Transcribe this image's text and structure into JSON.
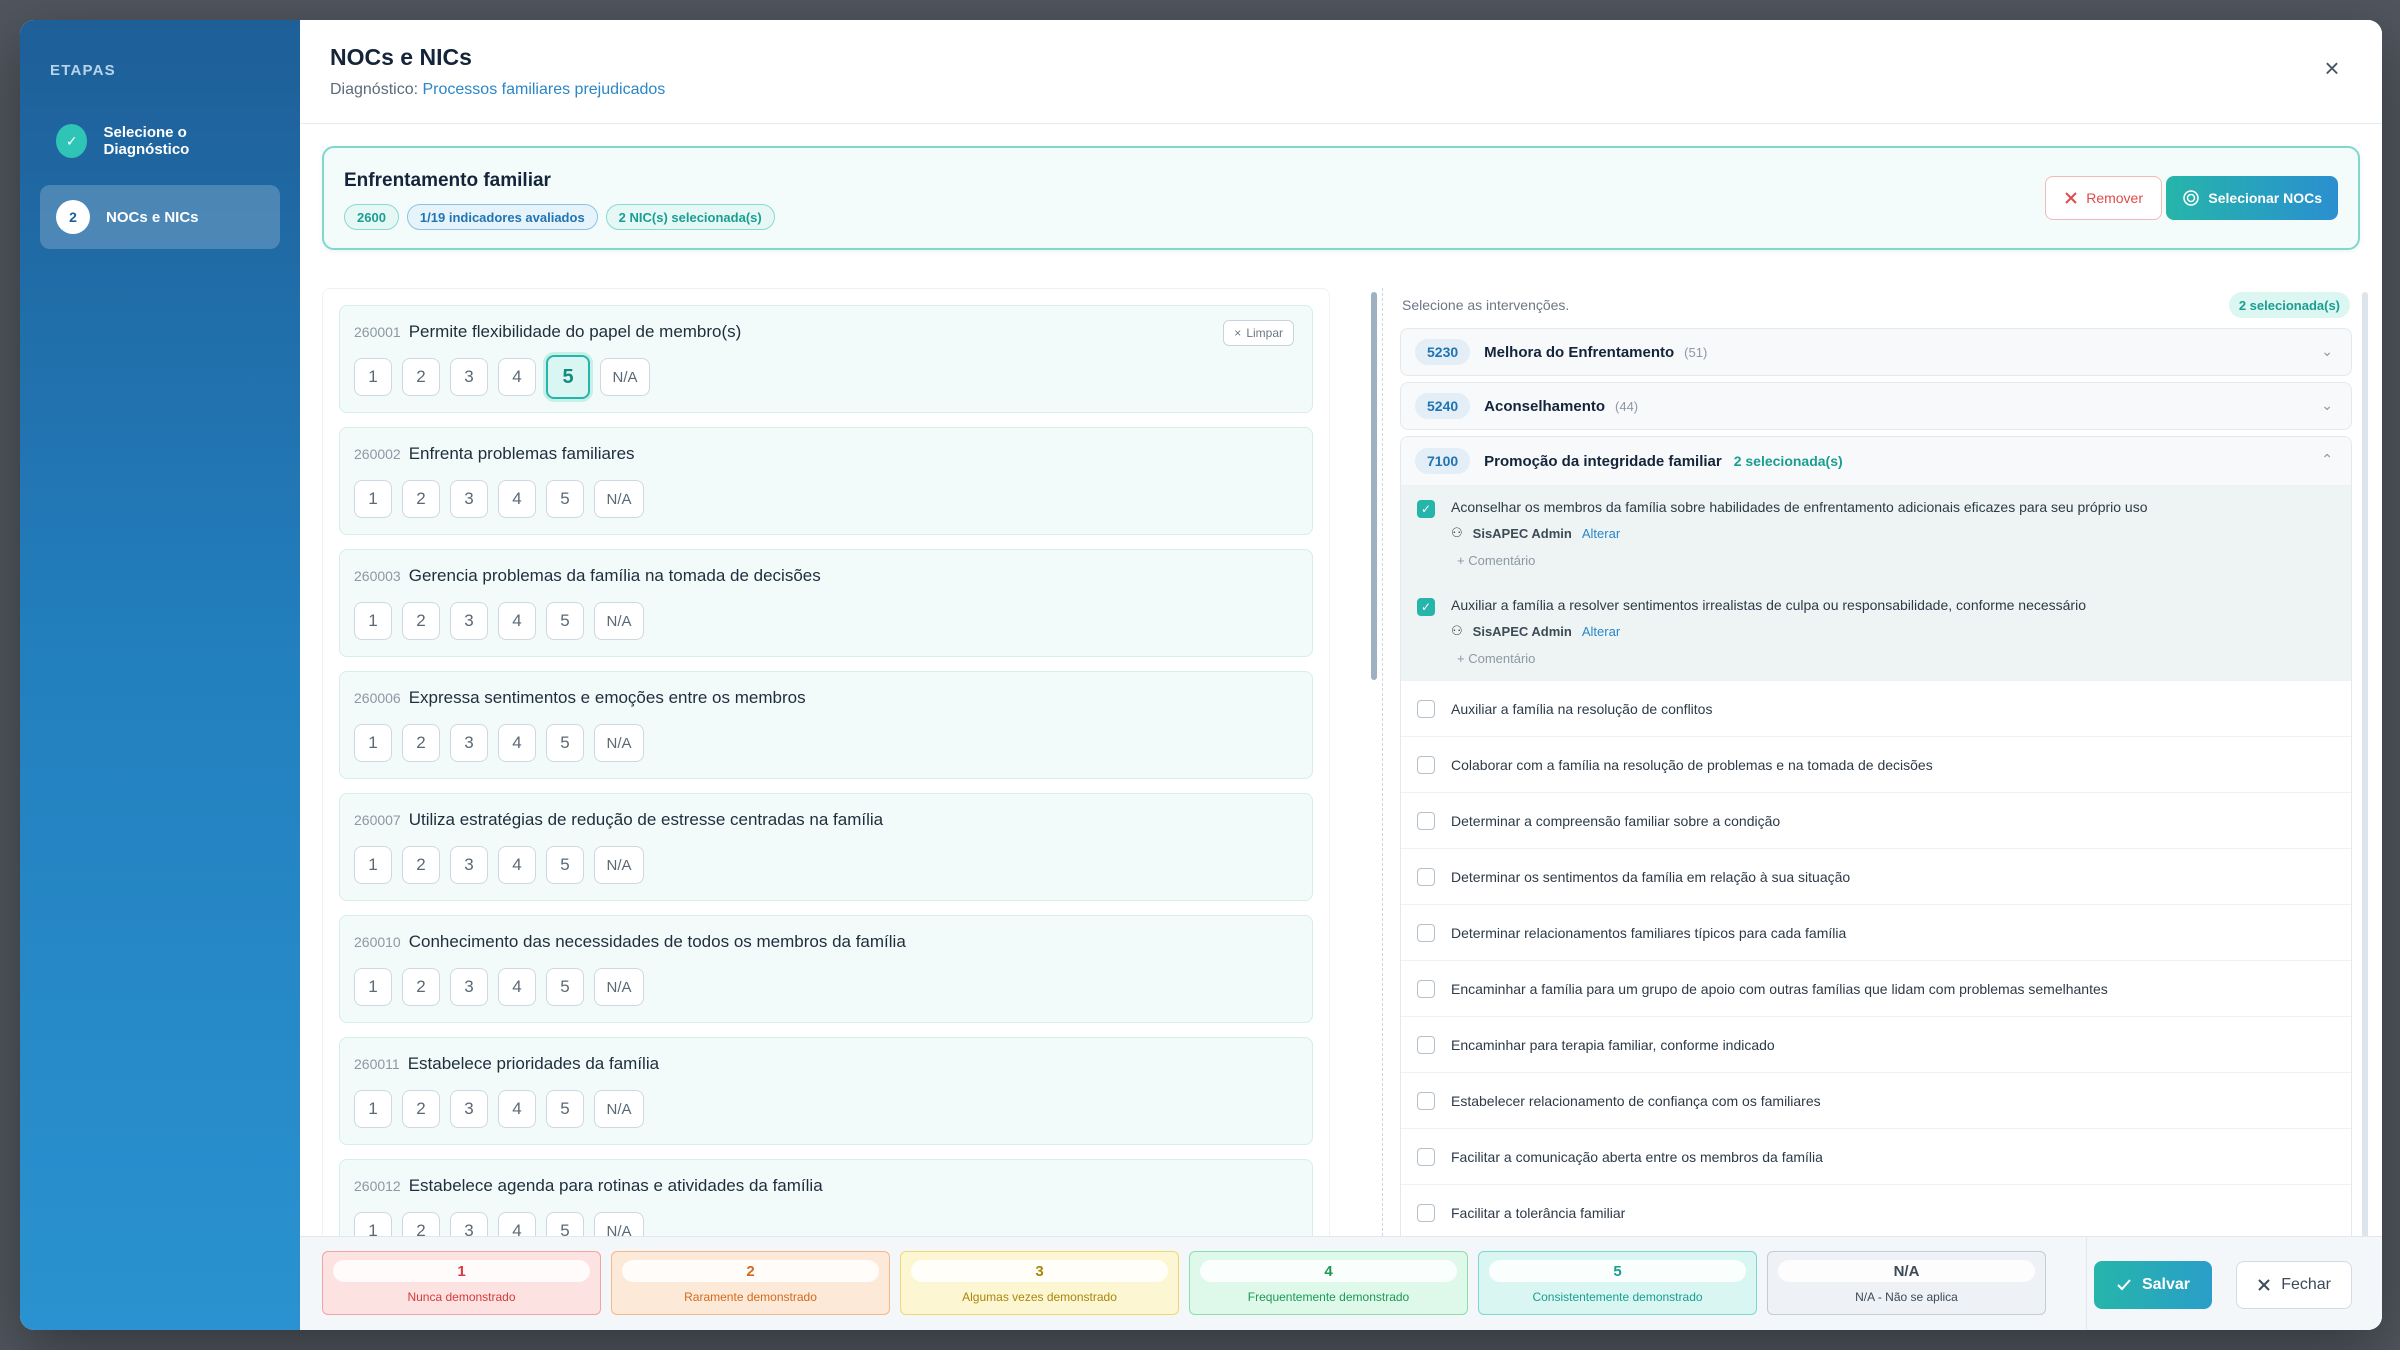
{
  "sidebar": {
    "heading": "ETAPAS",
    "steps": [
      {
        "label": "Selecione o Diagnóstico",
        "badge": "✓"
      },
      {
        "label": "NOCs e NICs",
        "badge": "2"
      }
    ]
  },
  "header": {
    "title": "NOCs e NICs",
    "diagnosis_label": "Diagnóstico:",
    "diagnosis_value": "Processos familiares prejudicados",
    "close_glyph": "×"
  },
  "noc": {
    "title": "Enfrentamento familiar",
    "chips": [
      "2600",
      "1/19 indicadores avaliados",
      "2 NIC(s) selecionada(s)"
    ],
    "remove_label": "Remover",
    "select_label": "Selecionar NOCs"
  },
  "indicators": {
    "clear_label": "Limpar",
    "scale": [
      "1",
      "2",
      "3",
      "4",
      "5",
      "N/A"
    ],
    "items": [
      {
        "code": "260001",
        "label": "Permite flexibilidade do papel de membro(s)",
        "selected": "5"
      },
      {
        "code": "260002",
        "label": "Enfrenta problemas familiares",
        "selected": null
      },
      {
        "code": "260003",
        "label": "Gerencia problemas da família na tomada de decisões",
        "selected": null
      },
      {
        "code": "260006",
        "label": "Expressa sentimentos e emoções entre os membros",
        "selected": null
      },
      {
        "code": "260007",
        "label": "Utiliza estratégias de redução de estresse centradas na família",
        "selected": null
      },
      {
        "code": "260010",
        "label": "Conhecimento das necessidades de todos os membros da família",
        "selected": null
      },
      {
        "code": "260011",
        "label": "Estabelece prioridades da família",
        "selected": null
      },
      {
        "code": "260012",
        "label": "Estabelece agenda para rotinas e atividades da família",
        "selected": null
      }
    ]
  },
  "interventions": {
    "hint": "Selecione as intervenções.",
    "count": "2 selecionada(s)",
    "nics": [
      {
        "code": "5230",
        "name": "Melhora do Enfrentamento",
        "paren": "(51)",
        "chevron": "⌄"
      },
      {
        "code": "5240",
        "name": "Aconselhamento",
        "paren": "(44)",
        "chevron": "⌄"
      }
    ],
    "open_nic": {
      "code": "7100",
      "name": "Promoção da integridade familiar",
      "selected": "2 selecionada(s)",
      "chevron": "⌃"
    },
    "activities_checked": [
      {
        "text": "Aconselhar os membros da família sobre habilidades de enfrentamento adicionais eficazes para seu próprio uso",
        "user": "SisAPEC Admin",
        "alter": "Alterar",
        "comment": "+ Comentário"
      },
      {
        "text": "Auxiliar a família a resolver sentimentos irrealistas de culpa ou responsabilidade, conforme necessário",
        "user": "SisAPEC Admin",
        "alter": "Alterar",
        "comment": "+ Comentário"
      }
    ],
    "activities": [
      "Auxiliar a família na resolução de conflitos",
      "Colaborar com a família na resolução de problemas e na tomada de decisões",
      "Determinar a compreensão familiar sobre a condição",
      "Determinar os sentimentos da família em relação à sua situação",
      "Determinar relacionamentos familiares típicos para cada família",
      "Encaminhar a família para um grupo de apoio com outras famílias que lidam com problemas semelhantes",
      "Encaminhar para terapia familiar, conforme indicado",
      "Estabelecer relacionamento de confiança com os familiares",
      "Facilitar a comunicação aberta entre os membros da família",
      "Facilitar a tolerância familiar"
    ]
  },
  "legend": [
    {
      "value": "1",
      "label": "Nunca demonstrado",
      "color": "#d63b3b"
    },
    {
      "value": "2",
      "label": "Raramente demonstrado",
      "color": "#d36a1d"
    },
    {
      "value": "3",
      "label": "Algumas vezes demonstrado",
      "color": "#a8870d"
    },
    {
      "value": "4",
      "label": "Frequentemente demonstrado",
      "color": "#1c9a55"
    },
    {
      "value": "5",
      "label": "Consistentemente demonstrado",
      "color": "#1a9e92"
    },
    {
      "value": "N/A",
      "label": "N/A - Não se aplica",
      "color": "#3d4a57"
    }
  ],
  "footer": {
    "save_label": "Salvar",
    "close_label": "Fechar"
  }
}
